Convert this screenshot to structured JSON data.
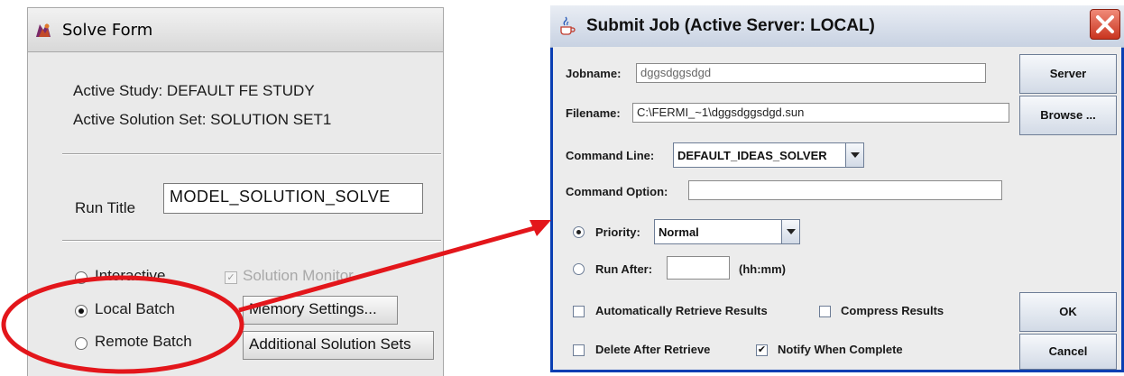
{
  "solve_form": {
    "title": "Solve Form",
    "active_study": "Active Study: DEFAULT FE STUDY",
    "active_solution_set": "Active Solution Set: SOLUTION SET1",
    "run_title_label": "Run Title",
    "run_title_value": "MODEL_SOLUTION_SOLVE",
    "options": [
      {
        "label": "Interactive",
        "selected": false
      },
      {
        "label": "Local Batch",
        "selected": true
      },
      {
        "label": "Remote Batch",
        "selected": false
      }
    ],
    "solution_monitor_label": "Solution Monitor",
    "solution_monitor_checked": true,
    "memory_settings_button": "Memory Settings...",
    "additional_solution_sets_button": "Additional Solution Sets"
  },
  "submit_job": {
    "title": "Submit Job (Active Server: LOCAL)",
    "jobname_label": "Jobname:",
    "jobname_value": "dggsdggsdgd",
    "filename_label": "Filename:",
    "filename_value": "C:\\FERMI_~1\\dggsdggsdgd.sun",
    "server_button": "Server",
    "browse_button": "Browse ...",
    "command_line_label": "Command Line:",
    "command_line_value": "DEFAULT_IDEAS_SOLVER",
    "command_option_label": "Command Option:",
    "command_option_value": "",
    "priority_label": "Priority:",
    "priority_value": "Normal",
    "priority_selected": true,
    "run_after_label": "Run After:",
    "run_after_value": "",
    "run_after_hint": "(hh:mm)",
    "auto_retrieve_label": "Automatically Retrieve Results",
    "auto_retrieve_checked": false,
    "compress_label": "Compress Results",
    "compress_checked": false,
    "delete_after_label": "Delete After Retrieve",
    "delete_after_checked": false,
    "notify_label": "Notify When Complete",
    "notify_checked": true,
    "ok_button": "OK",
    "cancel_button": "Cancel"
  },
  "colors": {
    "annotation_red": "#e3161b",
    "dialog_border": "#0a3fb3",
    "close_button": "#d9452f"
  },
  "icons": [
    "solve-form-app-icon",
    "java-cup-icon",
    "close-icon",
    "chevron-down-icon"
  ]
}
